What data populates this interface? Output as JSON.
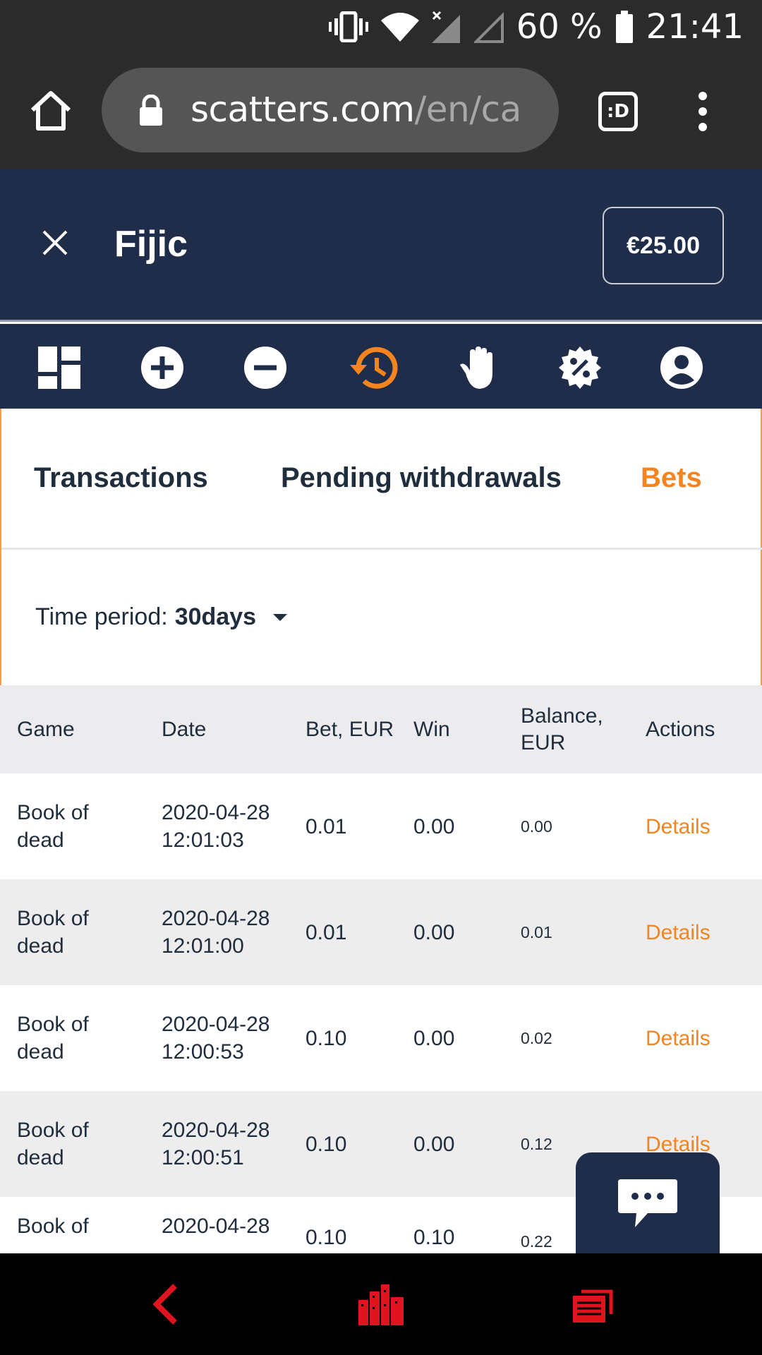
{
  "status_bar": {
    "battery": "60 %",
    "time": "21:41",
    "icons": [
      "vibrate-icon",
      "wifi-icon",
      "signal-off-icon",
      "signal-empty-icon",
      "battery-icon"
    ]
  },
  "browser": {
    "url_domain": "scatters.com",
    "url_path": "/en/ca",
    "tabs_label": ":D"
  },
  "header": {
    "username": "Fijic",
    "balance": "€25.00"
  },
  "icon_nav": {
    "items": [
      "dashboard-icon",
      "deposit-plus-icon",
      "withdraw-minus-icon",
      "history-icon",
      "limits-hand-icon",
      "bonus-percent-icon",
      "profile-icon"
    ],
    "active": "history-icon",
    "active_color": "#f5841f"
  },
  "tabs": [
    {
      "label": "Transactions",
      "active": false
    },
    {
      "label": "Pending withdrawals",
      "active": false
    },
    {
      "label": "Bets",
      "active": true
    }
  ],
  "filter": {
    "label": "Time period:",
    "value": "30days"
  },
  "table": {
    "columns": [
      "Game",
      "Date",
      "Bet, EUR",
      "Win",
      "Balance, EUR",
      "Actions"
    ],
    "rows": [
      {
        "game": "Book of dead",
        "date": "2020-04-28 12:01:03",
        "bet": "0.01",
        "win": "0.00",
        "balance": "0.00",
        "action": "Details"
      },
      {
        "game": "Book of dead",
        "date": "2020-04-28 12:01:00",
        "bet": "0.01",
        "win": "0.00",
        "balance": "0.01",
        "action": "Details"
      },
      {
        "game": "Book of dead",
        "date": "2020-04-28 12:00:53",
        "bet": "0.10",
        "win": "0.00",
        "balance": "0.02",
        "action": "Details"
      },
      {
        "game": "Book of dead",
        "date": "2020-04-28 12:00:51",
        "bet": "0.10",
        "win": "0.00",
        "balance": "0.12",
        "action": "Details"
      },
      {
        "game": "Book of",
        "date": "2020-04-28",
        "bet": "0.10",
        "win": "0.10",
        "balance": "0.22",
        "action": ""
      }
    ]
  },
  "chat_button": {
    "icon": "chat-bubble-icon"
  },
  "colors": {
    "navy": "#1f2d4b",
    "accent": "#f5841f",
    "system_nav": "#e0141e"
  }
}
